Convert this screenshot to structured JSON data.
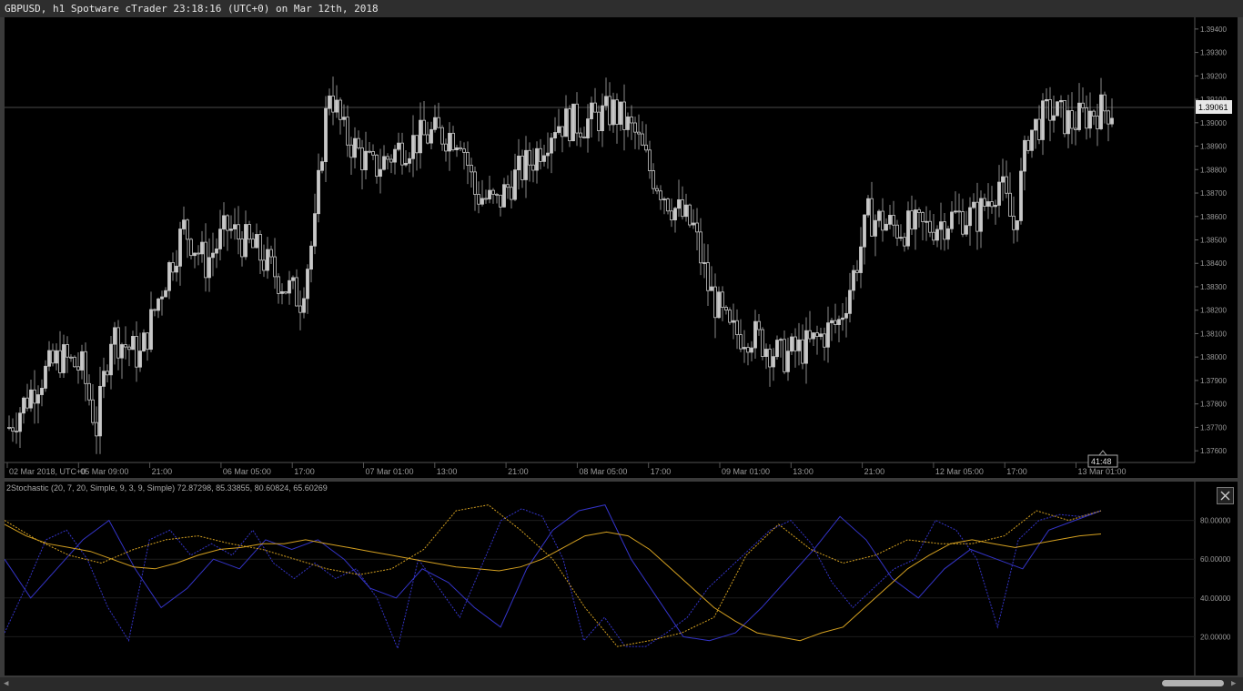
{
  "window": {
    "title": "GBPUSD, h1 Spotware cTrader 23:18:16 (UTC+0) on Mar 12th, 2018"
  },
  "price_chart": {
    "y_ticks": [
      "1.39400",
      "1.39300",
      "1.39200",
      "1.39100",
      "1.39000",
      "1.38900",
      "1.38800",
      "1.38700",
      "1.38600",
      "1.38500",
      "1.38400",
      "1.38300",
      "1.38200",
      "1.38100",
      "1.38000",
      "1.37900",
      "1.37800",
      "1.37700",
      "1.37600"
    ],
    "current_price": "1.39061",
    "countdown": "41:48",
    "x_labels": [
      "02 Mar 2018, UTC+0",
      "05 Mar 09:00",
      "21:00",
      "06 Mar 05:00",
      "17:00",
      "07 Mar 01:00",
      "13:00",
      "21:00",
      "08 Mar 05:00",
      "17:00",
      "09 Mar 01:00",
      "13:00",
      "21:00",
      "12 Mar 05:00",
      "17:00",
      "13 Mar 01:00"
    ]
  },
  "indicator": {
    "label": "2Stochastic (20, 7, 20, Simple, 9, 3, 9, Simple) 72.87298, 85.33855, 80.60824, 65.60269",
    "y_ticks": [
      "80.00000",
      "60.00000",
      "40.00000",
      "20.00000"
    ]
  },
  "colors": {
    "background": "#000000",
    "candle": "#c8c8c8",
    "stoch_fast": "#3434c8",
    "stoch_slow": "#d4a020",
    "grid": "#1a1a1a",
    "axis_text": "#9a9a9a"
  },
  "icons": {
    "close": "close-icon",
    "scroll_left": "arrow-left-icon",
    "scroll_right": "arrow-right-icon"
  },
  "chart_data": [
    {
      "type": "candlestick",
      "symbol": "GBPUSD",
      "timeframe": "h1",
      "ylim": [
        1.3755,
        1.3945
      ],
      "last_price": 1.39061,
      "close_trend": [
        [
          0,
          1.377
        ],
        [
          8,
          1.379
        ],
        [
          14,
          1.38
        ],
        [
          20,
          1.3795
        ],
        [
          24,
          1.377
        ],
        [
          28,
          1.381
        ],
        [
          36,
          1.38
        ],
        [
          42,
          1.383
        ],
        [
          48,
          1.3855
        ],
        [
          54,
          1.384
        ],
        [
          60,
          1.3855
        ],
        [
          68,
          1.3845
        ],
        [
          76,
          1.383
        ],
        [
          80,
          1.3825
        ],
        [
          84,
          1.3855
        ],
        [
          86,
          1.389
        ],
        [
          88,
          1.3915
        ],
        [
          92,
          1.3895
        ],
        [
          100,
          1.388
        ],
        [
          108,
          1.389
        ],
        [
          116,
          1.3895
        ],
        [
          124,
          1.3895
        ],
        [
          128,
          1.387
        ],
        [
          134,
          1.3865
        ],
        [
          138,
          1.3875
        ],
        [
          144,
          1.3885
        ],
        [
          150,
          1.39
        ],
        [
          158,
          1.39
        ],
        [
          166,
          1.3905
        ],
        [
          172,
          1.3895
        ],
        [
          176,
          1.388
        ],
        [
          182,
          1.3865
        ],
        [
          188,
          1.3855
        ],
        [
          192,
          1.383
        ],
        [
          198,
          1.381
        ],
        [
          204,
          1.381
        ],
        [
          212,
          1.38
        ],
        [
          220,
          1.3805
        ],
        [
          228,
          1.3815
        ],
        [
          232,
          1.3835
        ],
        [
          236,
          1.386
        ],
        [
          244,
          1.3855
        ],
        [
          252,
          1.3855
        ],
        [
          260,
          1.386
        ],
        [
          266,
          1.386
        ],
        [
          272,
          1.3875
        ],
        [
          276,
          1.3855
        ],
        [
          280,
          1.3895
        ],
        [
          286,
          1.3905
        ],
        [
          292,
          1.39
        ],
        [
          298,
          1.3905
        ],
        [
          303,
          1.3906
        ]
      ]
    },
    {
      "type": "line",
      "title": "2Stochastic (20, 7, 20, Simple, 9, 3, 9, Simple)",
      "ylim": [
        0,
        100
      ],
      "series": [
        {
          "values": [
            22,
            45,
            70,
            75,
            60,
            35,
            18,
            70,
            75,
            62,
            68,
            62,
            75,
            58,
            50,
            58,
            50,
            55,
            40,
            14,
            60,
            45,
            30,
            55,
            80,
            86,
            82,
            60,
            18,
            30,
            15,
            15,
            22,
            30,
            45,
            55,
            65,
            75,
            80,
            68,
            48,
            35,
            45,
            55,
            60,
            80,
            75,
            60,
            25,
            70,
            80,
            83,
            82,
            85
          ]
        },
        {
          "values": [
            60,
            40,
            55,
            70,
            80,
            55,
            35,
            45,
            60,
            55,
            70,
            65,
            70,
            60,
            45,
            40,
            55,
            48,
            35,
            25,
            55,
            75,
            85,
            88,
            60,
            40,
            20,
            18,
            22,
            35,
            50,
            65,
            82,
            70,
            50,
            40,
            55,
            65,
            60,
            55,
            75,
            80,
            85
          ]
        },
        {
          "values": [
            80,
            70,
            62,
            58,
            65,
            70,
            72,
            68,
            65,
            60,
            55,
            52,
            55,
            65,
            85,
            88,
            75,
            60,
            35,
            15,
            18,
            22,
            30,
            62,
            78,
            65,
            58,
            62,
            70,
            68,
            68,
            72,
            85,
            80,
            85
          ]
        },
        {
          "values": [
            78,
            72,
            68,
            66,
            64,
            60,
            56,
            55,
            58,
            62,
            65,
            66,
            68,
            68,
            70,
            68,
            66,
            64,
            62,
            60,
            58,
            56,
            55,
            54,
            56,
            60,
            66,
            72,
            74,
            72,
            65,
            55,
            45,
            35,
            28,
            22,
            20,
            18,
            22,
            25,
            35,
            45,
            55,
            62,
            68,
            70,
            68,
            66,
            68,
            70,
            72,
            73
          ]
        }
      ]
    }
  ]
}
